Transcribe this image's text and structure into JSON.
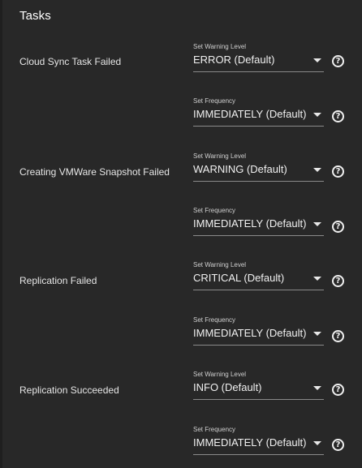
{
  "section": {
    "title": "Tasks"
  },
  "icons": {
    "help_glyph": "?",
    "help_icon_name": "help-circle-icon",
    "dropdown_icon_name": "arrow-drop-down-icon"
  },
  "tasks": [
    {
      "name": "Cloud Sync Task Failed",
      "warning_label": "Set Warning Level",
      "warning_value": "ERROR (Default)",
      "frequency_label": "Set Frequency",
      "frequency_value": "IMMEDIATELY (Default)"
    },
    {
      "name": "Creating VMWare Snapshot Failed",
      "warning_label": "Set Warning Level",
      "warning_value": "WARNING (Default)",
      "frequency_label": "Set Frequency",
      "frequency_value": "IMMEDIATELY (Default)"
    },
    {
      "name": "Replication Failed",
      "warning_label": "Set Warning Level",
      "warning_value": "CRITICAL (Default)",
      "frequency_label": "Set Frequency",
      "frequency_value": "IMMEDIATELY (Default)"
    },
    {
      "name": "Replication Succeeded",
      "warning_label": "Set Warning Level",
      "warning_value": "INFO (Default)",
      "frequency_label": "Set Frequency",
      "frequency_value": "IMMEDIATELY (Default)"
    }
  ]
}
